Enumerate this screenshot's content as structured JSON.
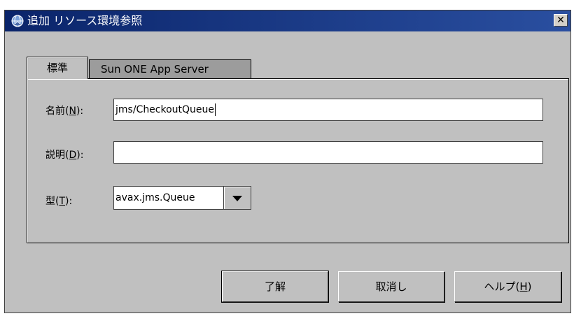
{
  "window": {
    "title": "追加 リソース環境参照",
    "close_glyph": "✕",
    "icon": "globe-app-icon"
  },
  "tabs": [
    {
      "label": "標準",
      "active": true
    },
    {
      "label": "Sun ONE App Server",
      "active": false
    }
  ],
  "form": {
    "name": {
      "label_prefix": "名前(",
      "mnemonic": "N",
      "label_suffix": "):",
      "value": "jms/CheckoutQueue"
    },
    "description": {
      "label_prefix": "説明(",
      "mnemonic": "D",
      "label_suffix": "):",
      "value": ""
    },
    "type": {
      "label_prefix": "型(",
      "mnemonic": "T",
      "label_suffix": "):",
      "selected": "avax.jms.Queue"
    }
  },
  "buttons": {
    "ok": "了解",
    "cancel": "取消し",
    "help_prefix": "ヘルプ(",
    "help_mnemonic": "H",
    "help_suffix": ")"
  },
  "colors": {
    "dialog_bg": "#c0c0c0",
    "titlebar": "#0a246a",
    "inactive_tab": "#9c9c9c"
  }
}
